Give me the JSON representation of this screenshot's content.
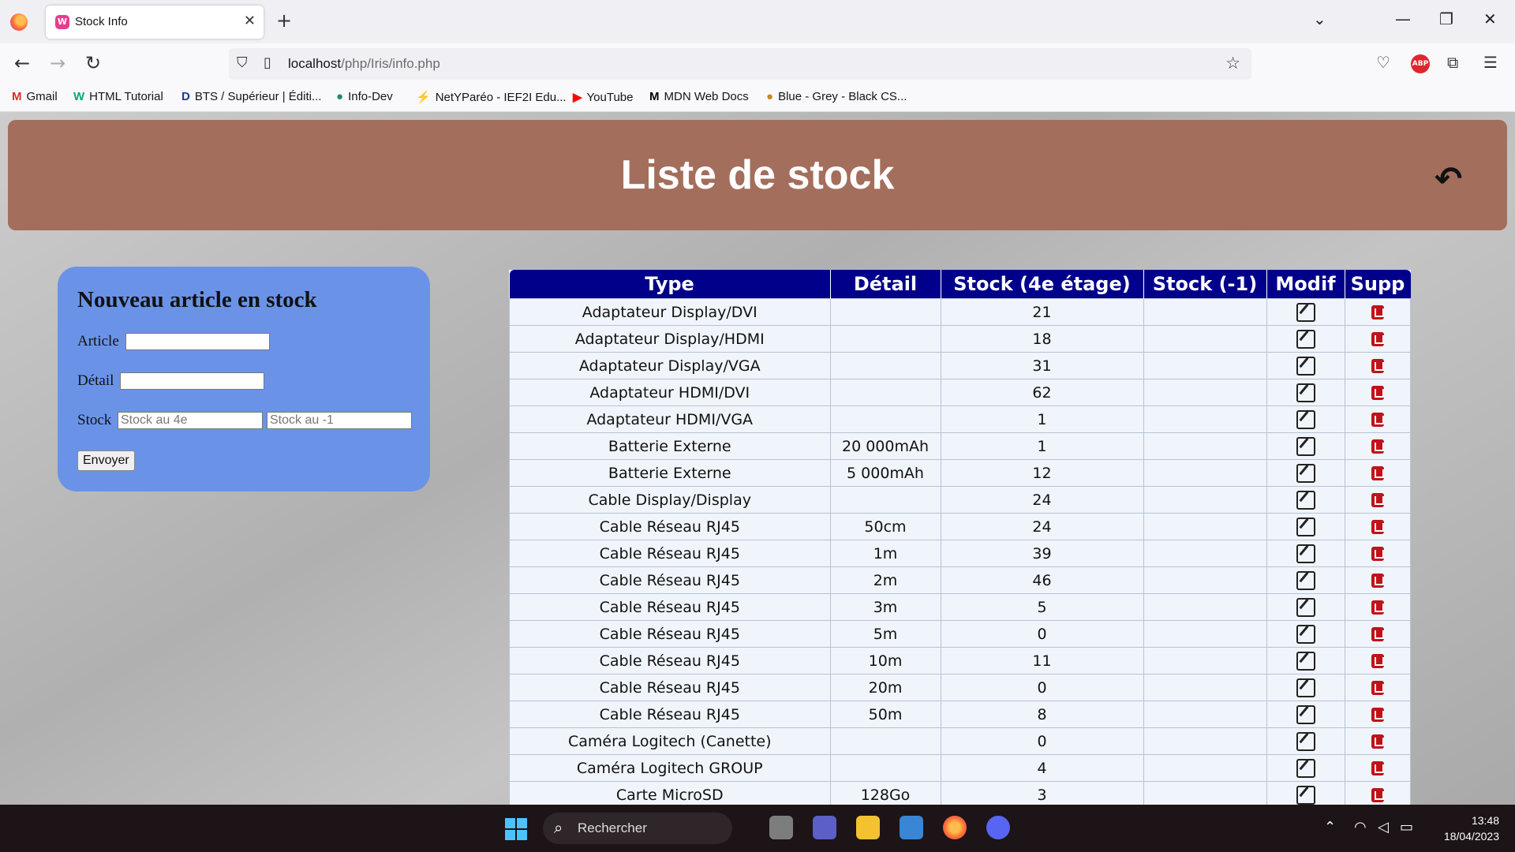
{
  "browser": {
    "tab_title": "Stock Info",
    "tab_favicon": "W",
    "url_host": "localhost",
    "url_path": "/php/Iris/info.php",
    "bookmarks": [
      {
        "icon": "M",
        "label": "Gmail"
      },
      {
        "icon": "W",
        "label": "HTML Tutorial"
      },
      {
        "icon": "D",
        "label": "BTS / Supérieur | Éditi..."
      },
      {
        "icon": "●",
        "label": "Info-Dev"
      },
      {
        "icon": "⚡",
        "label": "NetYParéo - IEF2I Edu..."
      },
      {
        "icon": "▶",
        "label": "YouTube"
      },
      {
        "icon": "M",
        "label": "MDN Web Docs"
      },
      {
        "icon": "●",
        "label": "Blue - Grey - Black CS..."
      }
    ],
    "abp_label": "ABP"
  },
  "header": {
    "title": "Liste de stock"
  },
  "form": {
    "title": "Nouveau article en stock",
    "article_label": "Article",
    "detail_label": "Détail",
    "stock_label": "Stock",
    "stock_4e_placeholder": "Stock au 4e",
    "stock_m1_placeholder": "Stock au -1",
    "submit_label": "Envoyer"
  },
  "table": {
    "headers": [
      "Type",
      "Détail",
      "Stock (4e étage)",
      "Stock (-1)",
      "Modif",
      "Supp"
    ],
    "rows": [
      {
        "type": "Adaptateur Display/DVI",
        "detail": "",
        "stock4": "21",
        "stockm1": ""
      },
      {
        "type": "Adaptateur Display/HDMI",
        "detail": "",
        "stock4": "18",
        "stockm1": ""
      },
      {
        "type": "Adaptateur Display/VGA",
        "detail": "",
        "stock4": "31",
        "stockm1": ""
      },
      {
        "type": "Adaptateur HDMI/DVI",
        "detail": "",
        "stock4": "62",
        "stockm1": ""
      },
      {
        "type": "Adaptateur HDMI/VGA",
        "detail": "",
        "stock4": "1",
        "stockm1": ""
      },
      {
        "type": "Batterie Externe",
        "detail": "20 000mAh",
        "stock4": "1",
        "stockm1": ""
      },
      {
        "type": "Batterie Externe",
        "detail": "5 000mAh",
        "stock4": "12",
        "stockm1": ""
      },
      {
        "type": "Cable Display/Display",
        "detail": "",
        "stock4": "24",
        "stockm1": ""
      },
      {
        "type": "Cable Réseau RJ45",
        "detail": "50cm",
        "stock4": "24",
        "stockm1": ""
      },
      {
        "type": "Cable Réseau RJ45",
        "detail": "1m",
        "stock4": "39",
        "stockm1": ""
      },
      {
        "type": "Cable Réseau RJ45",
        "detail": "2m",
        "stock4": "46",
        "stockm1": ""
      },
      {
        "type": "Cable Réseau RJ45",
        "detail": "3m",
        "stock4": "5",
        "stockm1": ""
      },
      {
        "type": "Cable Réseau RJ45",
        "detail": "5m",
        "stock4": "0",
        "stockm1": ""
      },
      {
        "type": "Cable Réseau RJ45",
        "detail": "10m",
        "stock4": "11",
        "stockm1": ""
      },
      {
        "type": "Cable Réseau RJ45",
        "detail": "20m",
        "stock4": "0",
        "stockm1": ""
      },
      {
        "type": "Cable Réseau RJ45",
        "detail": "50m",
        "stock4": "8",
        "stockm1": ""
      },
      {
        "type": "Caméra Logitech (Canette)",
        "detail": "",
        "stock4": "0",
        "stockm1": ""
      },
      {
        "type": "Caméra Logitech GROUP",
        "detail": "",
        "stock4": "4",
        "stockm1": ""
      },
      {
        "type": "Carte MicroSD",
        "detail": "128Go",
        "stock4": "3",
        "stockm1": ""
      }
    ]
  },
  "taskbar": {
    "search_label": "Rechercher",
    "time": "13:48",
    "date": "18/04/2023"
  },
  "colors": {
    "banner": "#a46e5c",
    "form_bg": "#6a93e8",
    "table_header": "#00008b",
    "delete_icon": "#c0121a"
  },
  "icons": {
    "edit": "edit-icon",
    "delete": "delete-icon",
    "back": "undo-arrow-icon"
  }
}
